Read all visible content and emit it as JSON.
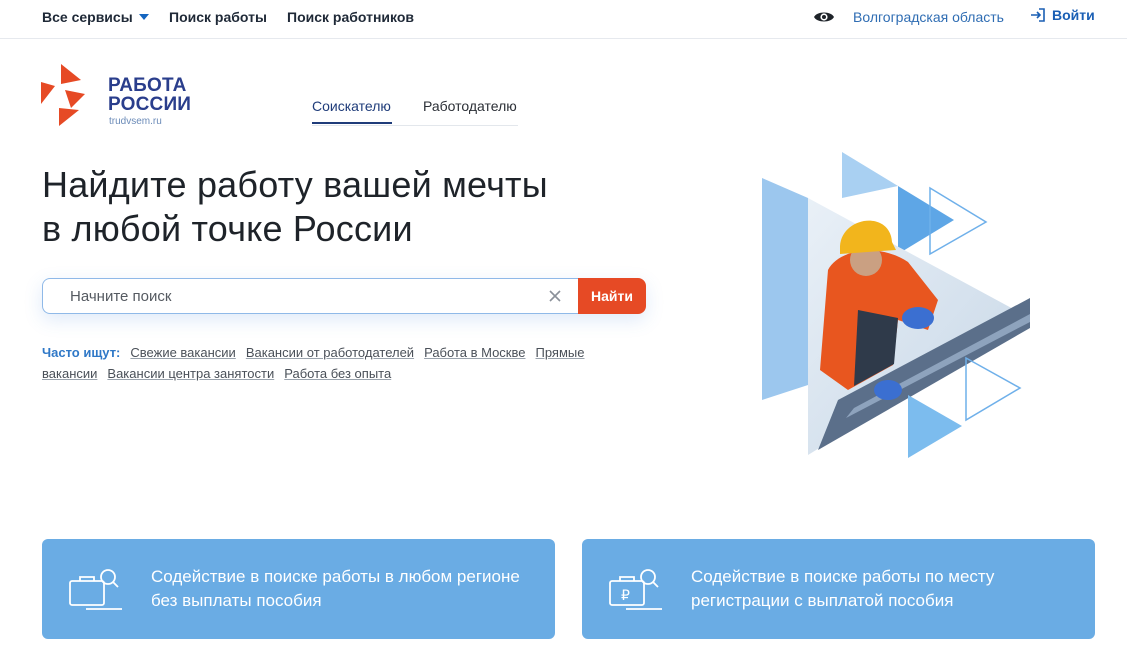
{
  "topbar": {
    "services_label": "Все сервисы",
    "job_search_label": "Поиск работы",
    "employee_search_label": "Поиск работников",
    "region_label": "Волгоградская область",
    "login_label": "Войти"
  },
  "logo": {
    "line1": "РАБОТА",
    "line2": "РОССИИ",
    "domain": "trudvsem.ru"
  },
  "tabs": [
    {
      "label": "Соискателю",
      "active": true
    },
    {
      "label": "Работодателю",
      "active": false
    }
  ],
  "hero": {
    "title_line1": "Найдите работу вашей мечты",
    "title_line2": "в любой точке России"
  },
  "search": {
    "placeholder": "Начните поиск",
    "value": "",
    "button_label": "Найти"
  },
  "popular": {
    "lead": "Часто ищут:",
    "links": [
      "Свежие вакансии",
      "Вакансии от работодателей",
      "Работа в Москве",
      "Прямые вакансии",
      "Вакансии центра занятости",
      "Работа без опыта"
    ]
  },
  "cards": [
    {
      "text": "Содействие в поиске работы в любом регионе без выплаты пособия",
      "icon": "briefcase-search-icon"
    },
    {
      "text": "Содействие в поиске работы по месту регистрации с выплатой пособия",
      "icon": "briefcase-ruble-search-icon"
    }
  ],
  "colors": {
    "accent_orange": "#e64a25",
    "brand_blue": "#2a3e8c",
    "card_blue": "#6aace4",
    "link_blue": "#2f6db3"
  }
}
